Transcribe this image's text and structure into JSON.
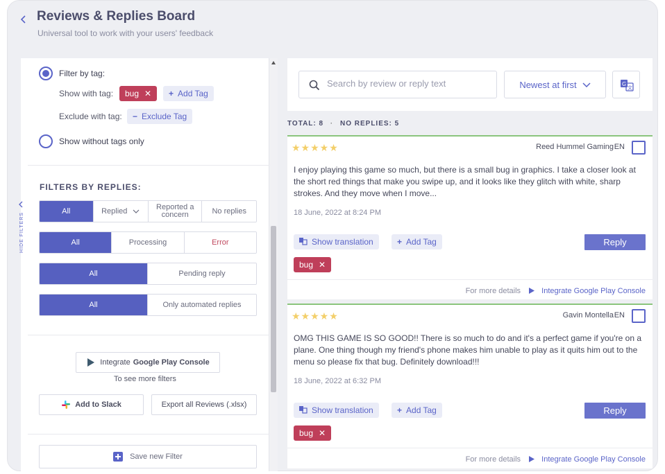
{
  "header": {
    "title": "Reviews & Replies Board",
    "subtitle": "Universal tool to work with your users' feedback"
  },
  "filters": {
    "hide_filters_label": "HIDE FILTERS",
    "by_tag": {
      "label": "Filter by tag:",
      "show_with_tag_label": "Show with tag:",
      "show_tag": "bug",
      "add_tag_label": "Add Tag",
      "exclude_with_tag_label": "Exclude with tag:",
      "exclude_tag_label": "Exclude Tag"
    },
    "without_tags_label": "Show without tags only",
    "by_replies": {
      "title": "FILTERS BY REPLIES:",
      "row1": [
        "All",
        "Replied",
        "Reported a concern",
        "No replies"
      ],
      "row2": [
        "All",
        "Processing",
        "Error"
      ],
      "row3": [
        "All",
        "Pending reply"
      ],
      "row4": [
        "All",
        "Only automated replies"
      ]
    },
    "integrate_label": "Integrate",
    "integrate_bold": "Google Play Console",
    "see_more_label": "To see more filters",
    "slack_label": "Add to Slack",
    "export_label": "Export all Reviews (.xlsx)",
    "save_filter_label": "Save new Filter"
  },
  "toolbar": {
    "search_placeholder": "Search by review or reply text",
    "sort_value": "Newest at first"
  },
  "totals": {
    "total_label": "TOTAL:",
    "total_value": "8",
    "sep": "·",
    "no_replies_label": "NO REPLIES:",
    "no_replies_value": "5"
  },
  "reviews": [
    {
      "stars": "★★★★★",
      "author": "Reed Hummel Gaming",
      "lang": "EN",
      "text": "I enjoy playing this game so much, but there is a small bug in graphics. I take a closer look at the short red things that make you swipe up, and it looks like they glitch with white, sharp strokes. And they move when I move...",
      "date": "18 June, 2022 at 8:24 PM",
      "show_translation": "Show translation",
      "add_tag": "Add Tag",
      "reply": "Reply",
      "tag": "bug",
      "more_details": "For more details",
      "integrate_link": "Integrate Google Play Console"
    },
    {
      "stars": "★★★★★",
      "author": "Gavin Montella",
      "lang": "EN",
      "text": "OMG THIS GAME IS SO GOOD!! There is so much to do and it's a perfect game if you're on a plane. One thing though my friend's phone makes him unable to play as it quits him out to the menu so please fix that bug. Definitely download!!!",
      "date": "18 June, 2022 at 6:32 PM",
      "show_translation": "Show translation",
      "add_tag": "Add Tag",
      "reply": "Reply",
      "tag": "bug",
      "more_details": "For more details",
      "integrate_link": "Integrate Google Play Console"
    }
  ],
  "colors": {
    "accent": "#5a64c8",
    "active_segment": "#5660c0",
    "tag": "#bf3f5a",
    "star": "#f3cf6a",
    "card_border": "#8ac47c"
  }
}
